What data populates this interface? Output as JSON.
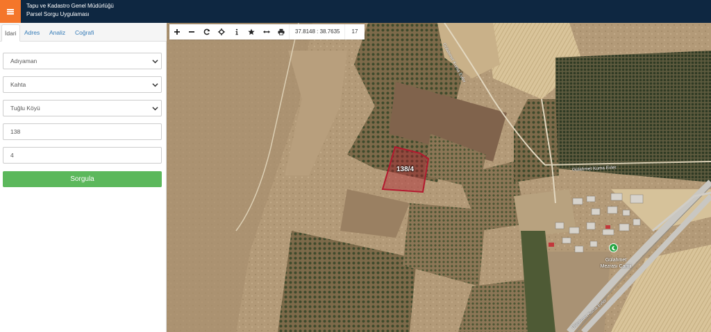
{
  "header": {
    "title_line1": "Tapu ve Kadastro Genel Müdürlüğü",
    "title_line2": "Parsel Sorgu Uygulaması",
    "menu_icon": "hamburger-icon",
    "accent_color": "#f4762a",
    "bg_color": "#0e2741"
  },
  "sidebar": {
    "tabs": [
      {
        "label": "İdari",
        "active": true
      },
      {
        "label": "Adres",
        "active": false
      },
      {
        "label": "Analiz",
        "active": false
      },
      {
        "label": "Coğrafi",
        "active": false
      }
    ],
    "province": "Adıyaman",
    "district": "Kahta",
    "neighborhood": "Tuğlu Köyü",
    "block_no": "138",
    "parcel_no": "4",
    "query_label": "Sorgula",
    "query_color": "#5cb85c"
  },
  "map": {
    "toolbar": {
      "tools": [
        "zoom-in-icon",
        "zoom-out-icon",
        "refresh-icon",
        "locate-icon",
        "info-icon",
        "favorite-icon",
        "measure-icon",
        "print-icon"
      ],
      "coordinates": "37.8148 : 38.7635",
      "zoom_level": "17"
    },
    "parcel_label": "138/4",
    "parcel_color": "#b3182e",
    "road_label_1": "Gülahmet Kuma Evler",
    "road_label_2": "Gülahmet Kuma Evler",
    "road_label_3": "Gülahmet Kuma Evler",
    "poi_line1": "Gülahmet",
    "poi_line2": "Mezrası Camii"
  }
}
